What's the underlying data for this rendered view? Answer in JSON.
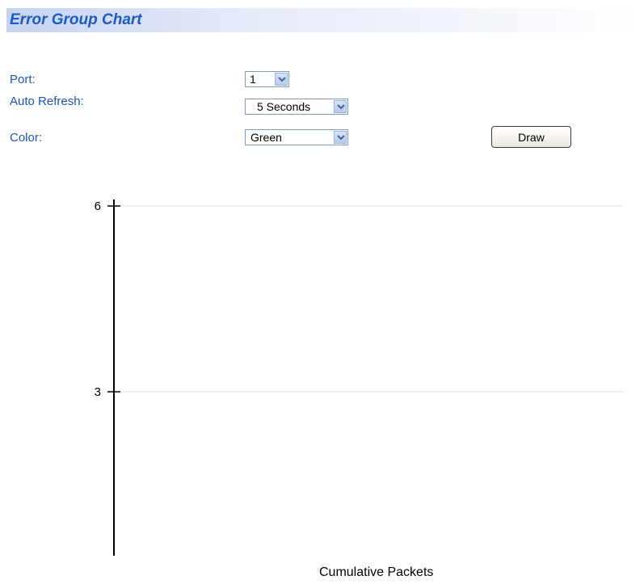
{
  "header": {
    "title": "Error Group Chart"
  },
  "form": {
    "port": {
      "label": "Port:",
      "value": "1"
    },
    "auto_refresh": {
      "label": "Auto Refresh:",
      "value": "5 Seconds"
    },
    "color": {
      "label": "Color:",
      "value": "Green"
    },
    "draw_label": "Draw"
  },
  "chart_data": {
    "type": "line",
    "xlabel": "Cumulative Packets",
    "ylabel": "",
    "yticks": [
      3,
      6
    ],
    "ylim": [
      0,
      7
    ],
    "gridlines": true,
    "series": []
  }
}
